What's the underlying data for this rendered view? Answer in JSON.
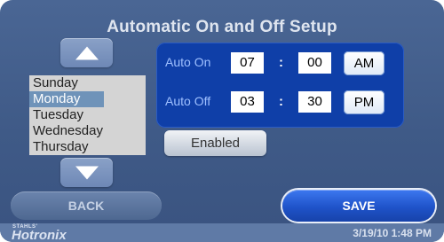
{
  "title": "Automatic On and Off Setup",
  "icons": {
    "scroll_up": "triangle-up-icon",
    "scroll_down": "triangle-down-icon"
  },
  "days": [
    "Sunday",
    "Monday",
    "Tuesday",
    "Wednesday",
    "Thursday"
  ],
  "selected_day": "Monday",
  "auto_on": {
    "label": "Auto On",
    "hour": "07",
    "minute": "00",
    "period": "AM"
  },
  "auto_off": {
    "label": "Auto Off",
    "hour": "03",
    "minute": "30",
    "period": "PM"
  },
  "separator": ":",
  "enabled_label": "Enabled",
  "buttons": {
    "back": "BACK",
    "save": "SAVE"
  },
  "footer": {
    "brand_small": "STAHLS'",
    "brand": "Hotronix",
    "datetime": "3/19/10  1:48 PM"
  },
  "colors": {
    "panel": "#0f3fa8",
    "save": "#1f53c9",
    "selected_day": "#6f93b9"
  }
}
